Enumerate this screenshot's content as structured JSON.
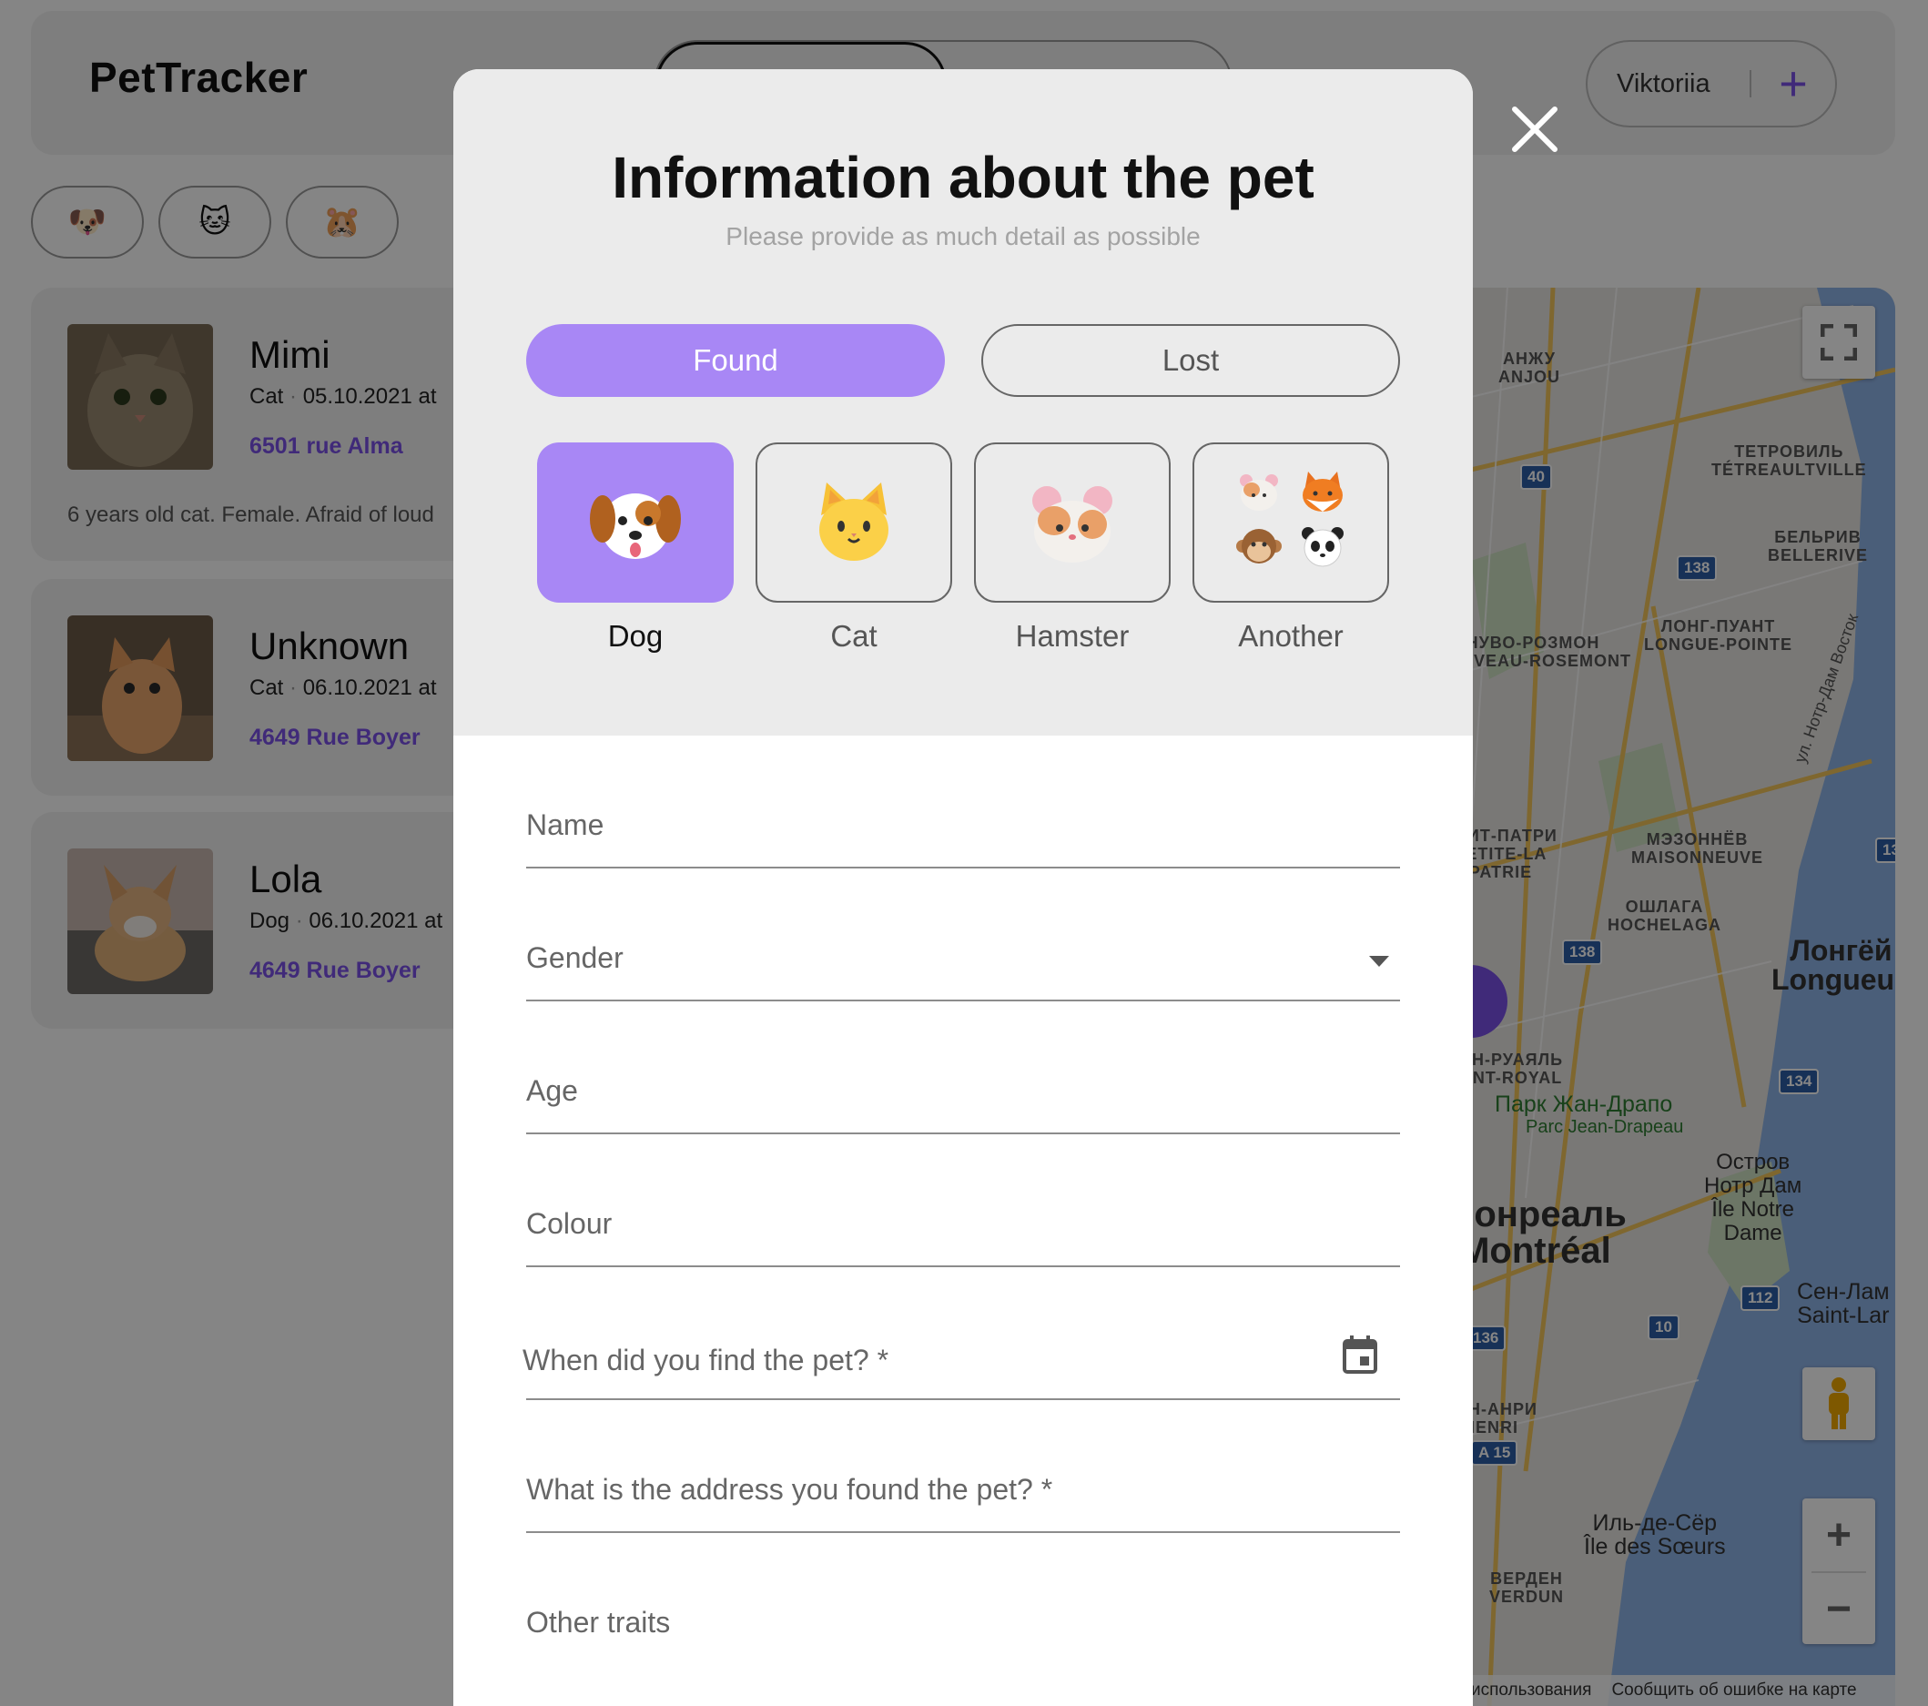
{
  "app": {
    "logo": "PetTracker"
  },
  "header": {
    "user_name": "Viktoriia",
    "add_icon": "plus-icon"
  },
  "filters": [
    {
      "emoji": "🐶",
      "name": "dog"
    },
    {
      "emoji": "🐱",
      "name": "cat"
    },
    {
      "emoji": "🐹",
      "name": "hamster"
    }
  ],
  "pets": [
    {
      "name": "Mimi",
      "species": "Cat",
      "datetime": "05.10.2021 at",
      "address": "6501 rue Alma",
      "description": "6 years old cat. Female. Afraid of loud"
    },
    {
      "name": "Unknown",
      "species": "Cat",
      "datetime": "06.10.2021 at",
      "address": "4649 Rue Boyer"
    },
    {
      "name": "Lola",
      "species": "Dog",
      "datetime": "06.10.2021 at",
      "address": "4649 Rue Boyer"
    }
  ],
  "map": {
    "labels": {
      "anjou": "АНЖУ\nANJOU",
      "tetreaultville": "ТЕТРОВИЛЬ\nTÉTREAULTVILLE",
      "bellerive": "БЕЛЬРИВ\nBELLERIVE",
      "longue_pointe": "ЛОНГ-ПУАНТ\nLONGUE-POINTE",
      "rosemont": "НУВО-РОЗМОН\nNOUVEAU-ROSEMONT",
      "notre_dame_street": "ул. Нотр-Дам Восток",
      "maisonneuve": "МЭЗОННЁВ\nMAISONNEUVE",
      "hochelaga": "ОШЛАГА\nHOCHELAGA",
      "petite_patrie": "ПТИТ-ПАТРИ\nPETITE-LA\nPATRIE",
      "longueuil": "Лонгёй\nLongueuil",
      "mont_royal": "МОН-РУАЯЛЬ\nMONT-ROYAL",
      "parc_jean_drapeau_ru": "Парк Жан-Драпо",
      "parc_jean_drapeau": "Parc Jean-Drapeau",
      "ile_notre_dame": "Остров\nНотр Дам\nÎle Notre\nDame",
      "montreal": "Монреаль\nMontréal",
      "saint_lambert": "Сен-Лам\nSaint-Lar",
      "henri": "СЕН-АНРИ\nHENRI",
      "ile_des_soeurs": "Иль-де-Сёр\nÎle des Sœurs",
      "verdun": "ВЕРДЕН\nVERDUN"
    },
    "road_badges": [
      "40",
      "138",
      "138",
      "134",
      "112",
      "10",
      "136",
      "A 15",
      "13"
    ],
    "footer_left": "использования",
    "footer_right": "Сообщить об ошибке на карте"
  },
  "modal": {
    "title": "Information about the pet",
    "subtitle": "Please provide as much detail as possible",
    "status_options": {
      "found": "Found",
      "lost": "Lost",
      "selected": "found"
    },
    "pet_types": [
      {
        "label": "Dog",
        "emoji": "🐶",
        "selected": true
      },
      {
        "label": "Cat",
        "emoji": "🐱",
        "selected": false
      },
      {
        "label": "Hamster",
        "emoji": "🐹",
        "selected": false
      },
      {
        "label": "Another",
        "emoji": [
          "🐹",
          "🦊",
          "🐵",
          "🐼"
        ],
        "selected": false
      }
    ],
    "fields": {
      "name": "Name",
      "gender": "Gender",
      "age": "Age",
      "colour": "Colour",
      "when_found": "When did you find the pet? *",
      "address": "What is the address you found the pet? *",
      "other_traits": "Other traits"
    }
  },
  "colors": {
    "accent": "#a887f5",
    "accent_dark": "#7b52e8",
    "modal_top": "#ebebeb",
    "overlay": "rgba(0,0,0,0.48)"
  }
}
